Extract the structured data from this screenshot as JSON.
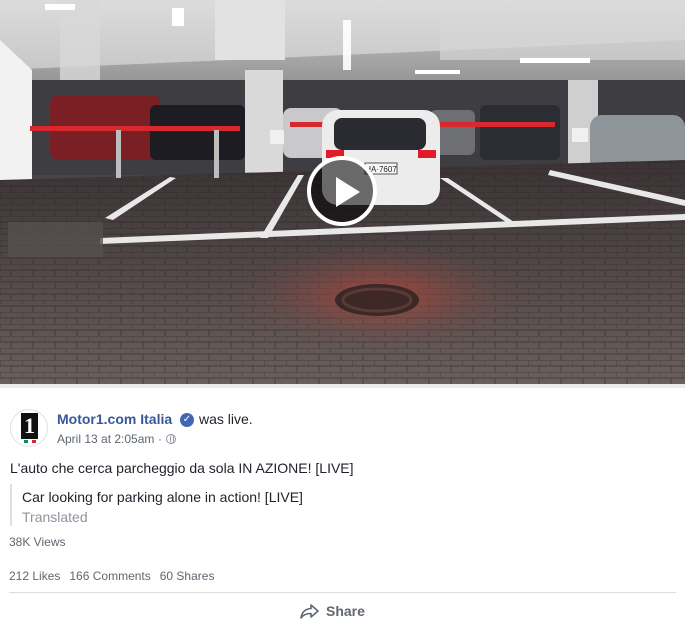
{
  "post": {
    "page_name": "Motor1.com Italia",
    "status": "was live.",
    "timestamp": "April 13 at 2:05am",
    "separator": "·",
    "text": "L'auto che cerca parcheggio da sola IN AZIONE! [LIVE]",
    "translation": {
      "text": "Car looking for parking alone in action! [LIVE]",
      "label": "Translated"
    },
    "views": "38K Views",
    "likes": "212 Likes",
    "comments": "166 Comments",
    "shares": "60 Shares",
    "share_label": "Share",
    "avatar_text": "1",
    "video_plate": "HA·7607"
  },
  "icons": {
    "play": "play-icon",
    "verified": "verified-badge-icon",
    "privacy": "globe-icon",
    "share": "share-arrow-icon"
  },
  "colors": {
    "link": "#365899",
    "verified": "#4267b2",
    "meta": "#606770",
    "muted": "#90949c"
  }
}
